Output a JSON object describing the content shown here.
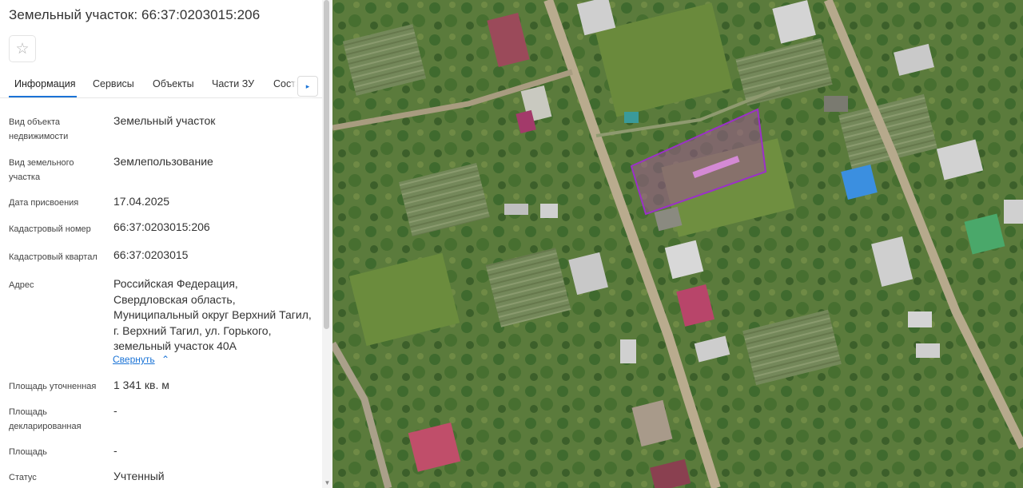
{
  "panel": {
    "title": "Земельный участок: 66:37:0203015:206",
    "star_glyph": "☆",
    "tabs": [
      {
        "label": "Информация",
        "active": true
      },
      {
        "label": "Сервисы",
        "active": false
      },
      {
        "label": "Объекты",
        "active": false
      },
      {
        "label": "Части ЗУ",
        "active": false
      },
      {
        "label": "Состав",
        "active": false
      }
    ],
    "next_glyph": "▸",
    "fields": [
      {
        "label": "Вид объекта недвижимости",
        "value": "Земельный участок"
      },
      {
        "label": "Вид земельного участка",
        "value": "Землепользование"
      },
      {
        "label": "Дата присвоения",
        "value": "17.04.2025"
      },
      {
        "label": "Кадастровый номер",
        "value": "66:37:0203015:206"
      },
      {
        "label": "Кадастровый квартал",
        "value": "66:37:0203015"
      },
      {
        "label": "Адрес",
        "value": "Российская Федерация, Свердловская область, Муниципальный округ Верхний Тагил, г. Верхний Тагил, ул. Горького, земельный участок 40А"
      },
      {
        "label": "Площадь уточненная",
        "value": "1 341 кв. м"
      },
      {
        "label": "Площадь декларированная",
        "value": "-"
      },
      {
        "label": "Площадь",
        "value": "-"
      },
      {
        "label": "Статус",
        "value": "Учтенный"
      }
    ],
    "collapse_label": "Свернуть",
    "collapse_glyph": "⌃"
  },
  "map": {
    "parcel_outline_color": "#9b30c8",
    "imagery": "satellite"
  },
  "colors": {
    "accent": "#1a73d6",
    "parcel": "#9b30c8"
  },
  "icons": [
    "star-icon",
    "chevron-right-icon",
    "chevron-up-icon"
  ]
}
